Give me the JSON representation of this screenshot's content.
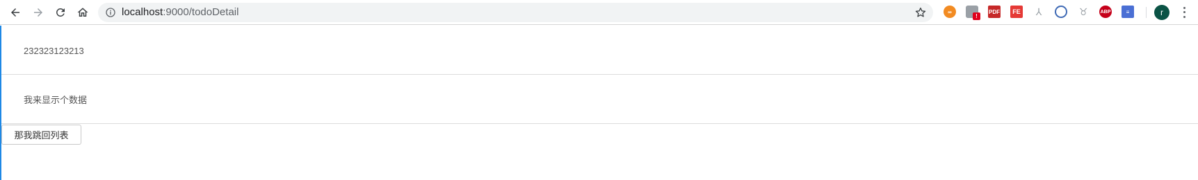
{
  "browser": {
    "url_host": "localhost",
    "url_rest": ":9000/todoDetail",
    "extensions": [
      "infinity-icon",
      "puzzle-ext-icon",
      "pdf-ext-icon",
      "fe-ext-icon",
      "tree-ext-icon",
      "globe-ext-icon",
      "shield-ext-icon",
      "adblock-icon",
      "notes-ext-icon"
    ],
    "ext_labels": {
      "ext2_badge": "!",
      "ext3": "PDF",
      "ext4": "FE",
      "ext8": "ABP"
    },
    "avatar_letter": "r"
  },
  "detail": {
    "item_id": "232323123213",
    "item_text": "我来显示个数据"
  },
  "actions": {
    "back_to_list": "那我跳回列表"
  },
  "colors": {
    "left_border": "#1e88e5",
    "text": "#555555",
    "divider": "#dcdcdc"
  }
}
